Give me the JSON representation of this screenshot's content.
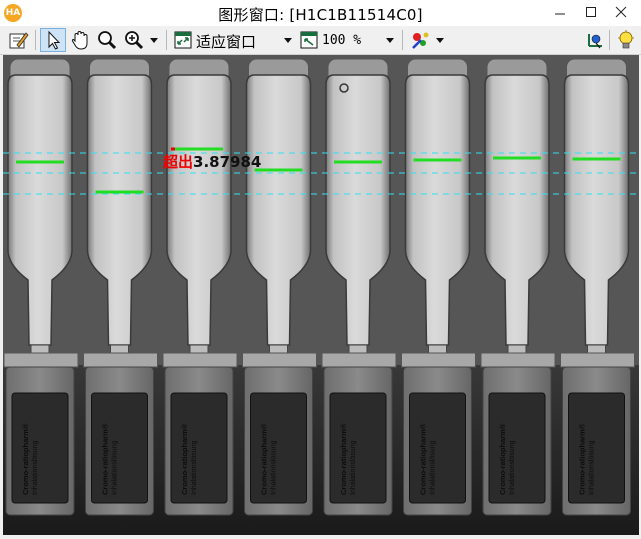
{
  "window": {
    "title": "图形窗口: [H1C1B11514C0]",
    "app_icon_text": "HA",
    "controls": [
      "minimize-icon",
      "maximize-icon",
      "close-icon"
    ]
  },
  "toolbar": {
    "buttons": [
      "edit-icon",
      "pointer-icon",
      "hand-pan-icon",
      "magnifier-icon",
      "zoom-in-icon",
      "fit-window-icon",
      "zoom-100-icon",
      "color-settings-icon",
      "axis-icon",
      "lightbulb-icon"
    ],
    "zoom_mode": "适应窗口",
    "zoom_percent": "100 %"
  },
  "image": {
    "overlay_prefix": "超出",
    "overlay_value": "3.87984",
    "vial_count": 8,
    "label_texts": [
      "Cromo-ratiopharm®",
      "Inhalationslösung"
    ],
    "colors": {
      "level_line": "#22dd22",
      "reference_line": "#30e0f0",
      "exceed_line": "#ee0000"
    }
  }
}
